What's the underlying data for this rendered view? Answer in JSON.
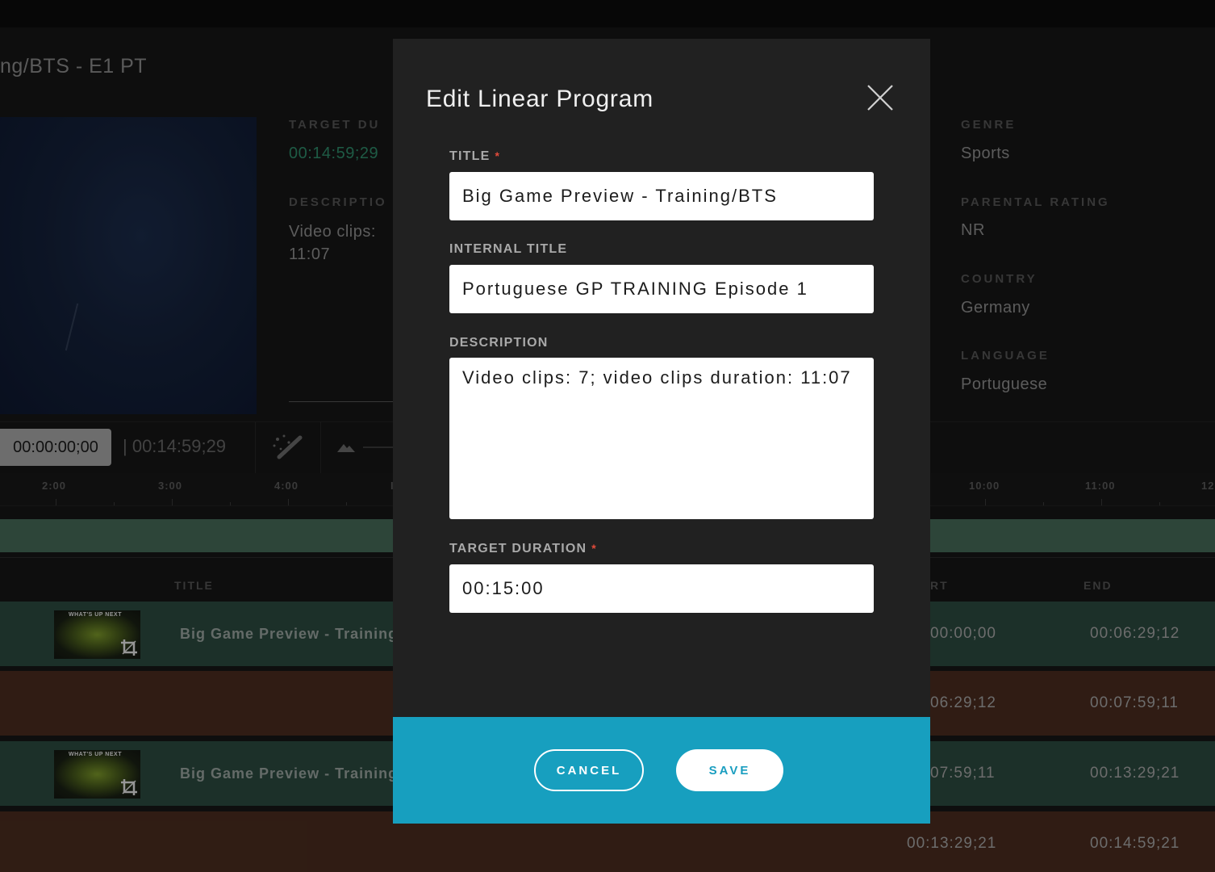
{
  "background": {
    "page_title": "ng/BTS - E1 PT",
    "meta": {
      "target_duration_label": "TARGET DU",
      "target_duration_value": "00:14:59;29",
      "description_label": "DESCRIPTIO",
      "description_line1": "Video clips:",
      "description_line2": "11:07",
      "genre_label": "GENRE",
      "genre_value": "Sports",
      "parental_label": "PARENTAL RATING",
      "parental_value": "NR",
      "country_label": "COUNTRY",
      "country_value": "Germany",
      "language_label": "LANGUAGE",
      "language_value": "Portuguese"
    },
    "controls": {
      "current_time": "00:00:00;00",
      "total_time": "| 00:14:59;29"
    },
    "ruler": {
      "ticks_left": [
        "2:00",
        "3:00",
        "4:00",
        "I"
      ],
      "ticks_right": [
        "10:00",
        "11:00",
        "12"
      ]
    },
    "table": {
      "col_title": "TITLE",
      "col_start": "RT",
      "col_end": "END",
      "thumb_caption": "WHAT'S UP NEXT",
      "rows": [
        {
          "title": "Big Game Preview - Training",
          "start": "00:00;00",
          "end": "00:06:29;12"
        },
        {
          "title": "",
          "start": "06:29;12",
          "end": "00:07:59;11"
        },
        {
          "title": "Big Game Preview - Training",
          "start": "07:59;11",
          "end": "00:13:29;21"
        },
        {
          "title": "",
          "start": "00:13:29;21",
          "end": "00:14:59;21"
        }
      ]
    }
  },
  "modal": {
    "title": "Edit Linear Program",
    "required_mark": "*",
    "fields": {
      "title_label": "TITLE",
      "title_value": "Big Game Preview - Training/BTS",
      "internal_title_label": "INTERNAL TITLE",
      "internal_title_value": "Portuguese GP TRAINING Episode 1",
      "description_label": "DESCRIPTION",
      "description_value": "Video clips: 7; video clips duration: 11:07",
      "target_duration_label": "TARGET DURATION",
      "target_duration_value": "00:15:00"
    },
    "buttons": {
      "cancel": "CANCEL",
      "save": "SAVE"
    }
  },
  "colors": {
    "accent": "#179fbf",
    "required": "#e24b3b",
    "green_row": "#2c4a40",
    "brown_row": "#4a2c1f"
  }
}
